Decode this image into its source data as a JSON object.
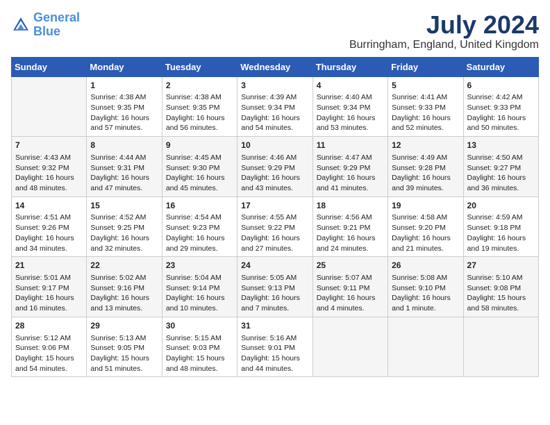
{
  "header": {
    "logo_line1": "General",
    "logo_line2": "Blue",
    "month_year": "July 2024",
    "location": "Burringham, England, United Kingdom"
  },
  "days_of_week": [
    "Sunday",
    "Monday",
    "Tuesday",
    "Wednesday",
    "Thursday",
    "Friday",
    "Saturday"
  ],
  "weeks": [
    [
      {
        "day": "",
        "text": ""
      },
      {
        "day": "1",
        "text": "Sunrise: 4:38 AM\nSunset: 9:35 PM\nDaylight: 16 hours\nand 57 minutes."
      },
      {
        "day": "2",
        "text": "Sunrise: 4:38 AM\nSunset: 9:35 PM\nDaylight: 16 hours\nand 56 minutes."
      },
      {
        "day": "3",
        "text": "Sunrise: 4:39 AM\nSunset: 9:34 PM\nDaylight: 16 hours\nand 54 minutes."
      },
      {
        "day": "4",
        "text": "Sunrise: 4:40 AM\nSunset: 9:34 PM\nDaylight: 16 hours\nand 53 minutes."
      },
      {
        "day": "5",
        "text": "Sunrise: 4:41 AM\nSunset: 9:33 PM\nDaylight: 16 hours\nand 52 minutes."
      },
      {
        "day": "6",
        "text": "Sunrise: 4:42 AM\nSunset: 9:33 PM\nDaylight: 16 hours\nand 50 minutes."
      }
    ],
    [
      {
        "day": "7",
        "text": "Sunrise: 4:43 AM\nSunset: 9:32 PM\nDaylight: 16 hours\nand 48 minutes."
      },
      {
        "day": "8",
        "text": "Sunrise: 4:44 AM\nSunset: 9:31 PM\nDaylight: 16 hours\nand 47 minutes."
      },
      {
        "day": "9",
        "text": "Sunrise: 4:45 AM\nSunset: 9:30 PM\nDaylight: 16 hours\nand 45 minutes."
      },
      {
        "day": "10",
        "text": "Sunrise: 4:46 AM\nSunset: 9:29 PM\nDaylight: 16 hours\nand 43 minutes."
      },
      {
        "day": "11",
        "text": "Sunrise: 4:47 AM\nSunset: 9:29 PM\nDaylight: 16 hours\nand 41 minutes."
      },
      {
        "day": "12",
        "text": "Sunrise: 4:49 AM\nSunset: 9:28 PM\nDaylight: 16 hours\nand 39 minutes."
      },
      {
        "day": "13",
        "text": "Sunrise: 4:50 AM\nSunset: 9:27 PM\nDaylight: 16 hours\nand 36 minutes."
      }
    ],
    [
      {
        "day": "14",
        "text": "Sunrise: 4:51 AM\nSunset: 9:26 PM\nDaylight: 16 hours\nand 34 minutes."
      },
      {
        "day": "15",
        "text": "Sunrise: 4:52 AM\nSunset: 9:25 PM\nDaylight: 16 hours\nand 32 minutes."
      },
      {
        "day": "16",
        "text": "Sunrise: 4:54 AM\nSunset: 9:23 PM\nDaylight: 16 hours\nand 29 minutes."
      },
      {
        "day": "17",
        "text": "Sunrise: 4:55 AM\nSunset: 9:22 PM\nDaylight: 16 hours\nand 27 minutes."
      },
      {
        "day": "18",
        "text": "Sunrise: 4:56 AM\nSunset: 9:21 PM\nDaylight: 16 hours\nand 24 minutes."
      },
      {
        "day": "19",
        "text": "Sunrise: 4:58 AM\nSunset: 9:20 PM\nDaylight: 16 hours\nand 21 minutes."
      },
      {
        "day": "20",
        "text": "Sunrise: 4:59 AM\nSunset: 9:18 PM\nDaylight: 16 hours\nand 19 minutes."
      }
    ],
    [
      {
        "day": "21",
        "text": "Sunrise: 5:01 AM\nSunset: 9:17 PM\nDaylight: 16 hours\nand 16 minutes."
      },
      {
        "day": "22",
        "text": "Sunrise: 5:02 AM\nSunset: 9:16 PM\nDaylight: 16 hours\nand 13 minutes."
      },
      {
        "day": "23",
        "text": "Sunrise: 5:04 AM\nSunset: 9:14 PM\nDaylight: 16 hours\nand 10 minutes."
      },
      {
        "day": "24",
        "text": "Sunrise: 5:05 AM\nSunset: 9:13 PM\nDaylight: 16 hours\nand 7 minutes."
      },
      {
        "day": "25",
        "text": "Sunrise: 5:07 AM\nSunset: 9:11 PM\nDaylight: 16 hours\nand 4 minutes."
      },
      {
        "day": "26",
        "text": "Sunrise: 5:08 AM\nSunset: 9:10 PM\nDaylight: 16 hours\nand 1 minute."
      },
      {
        "day": "27",
        "text": "Sunrise: 5:10 AM\nSunset: 9:08 PM\nDaylight: 15 hours\nand 58 minutes."
      }
    ],
    [
      {
        "day": "28",
        "text": "Sunrise: 5:12 AM\nSunset: 9:06 PM\nDaylight: 15 hours\nand 54 minutes."
      },
      {
        "day": "29",
        "text": "Sunrise: 5:13 AM\nSunset: 9:05 PM\nDaylight: 15 hours\nand 51 minutes."
      },
      {
        "day": "30",
        "text": "Sunrise: 5:15 AM\nSunset: 9:03 PM\nDaylight: 15 hours\nand 48 minutes."
      },
      {
        "day": "31",
        "text": "Sunrise: 5:16 AM\nSunset: 9:01 PM\nDaylight: 15 hours\nand 44 minutes."
      },
      {
        "day": "",
        "text": ""
      },
      {
        "day": "",
        "text": ""
      },
      {
        "day": "",
        "text": ""
      }
    ]
  ]
}
